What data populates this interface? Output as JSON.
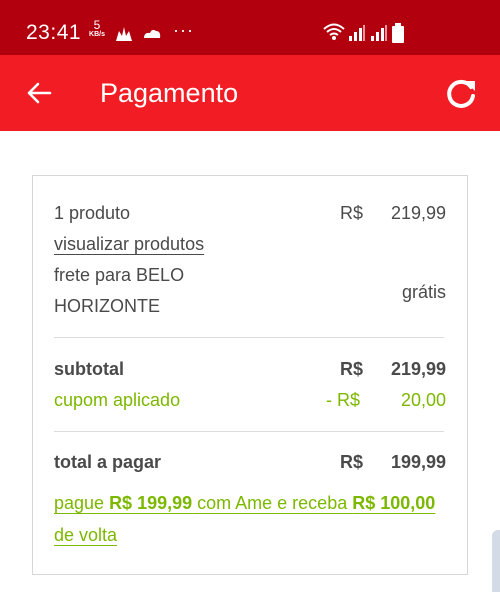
{
  "status_bar": {
    "time": "23:41",
    "net_speed_value": "5",
    "net_speed_unit": "KB/s",
    "overflow_dots": "···"
  },
  "app_bar": {
    "title": "Pagamento"
  },
  "summary": {
    "products_label": "1 produto",
    "products_currency": "R$",
    "products_value": "219,99",
    "view_products_link": "visualizar produtos",
    "shipping_label_line1": "frete para BELO",
    "shipping_label_line2": "HORIZONTE",
    "shipping_value": "grátis",
    "subtotal_label": "subtotal",
    "subtotal_currency": "R$",
    "subtotal_value": "219,99",
    "coupon_label": "cupom aplicado",
    "coupon_currency": "- R$",
    "coupon_value": "20,00",
    "total_label": "total a pagar",
    "total_currency": "R$",
    "total_value": "199,99",
    "cashback": {
      "part1": "pague ",
      "amount1": "R$ 199,99",
      "part2": " com Ame e receba ",
      "amount2": "R$ 100,00",
      "part3": " de volta"
    }
  },
  "colors": {
    "status_bar": "#b2000f",
    "app_bar": "#f21c24",
    "accent_green": "#7cb800",
    "text": "#4a4a4a"
  },
  "icons": [
    "back-arrow-icon",
    "refresh-icon",
    "wifi-icon",
    "signal-icon",
    "battery-icon"
  ]
}
